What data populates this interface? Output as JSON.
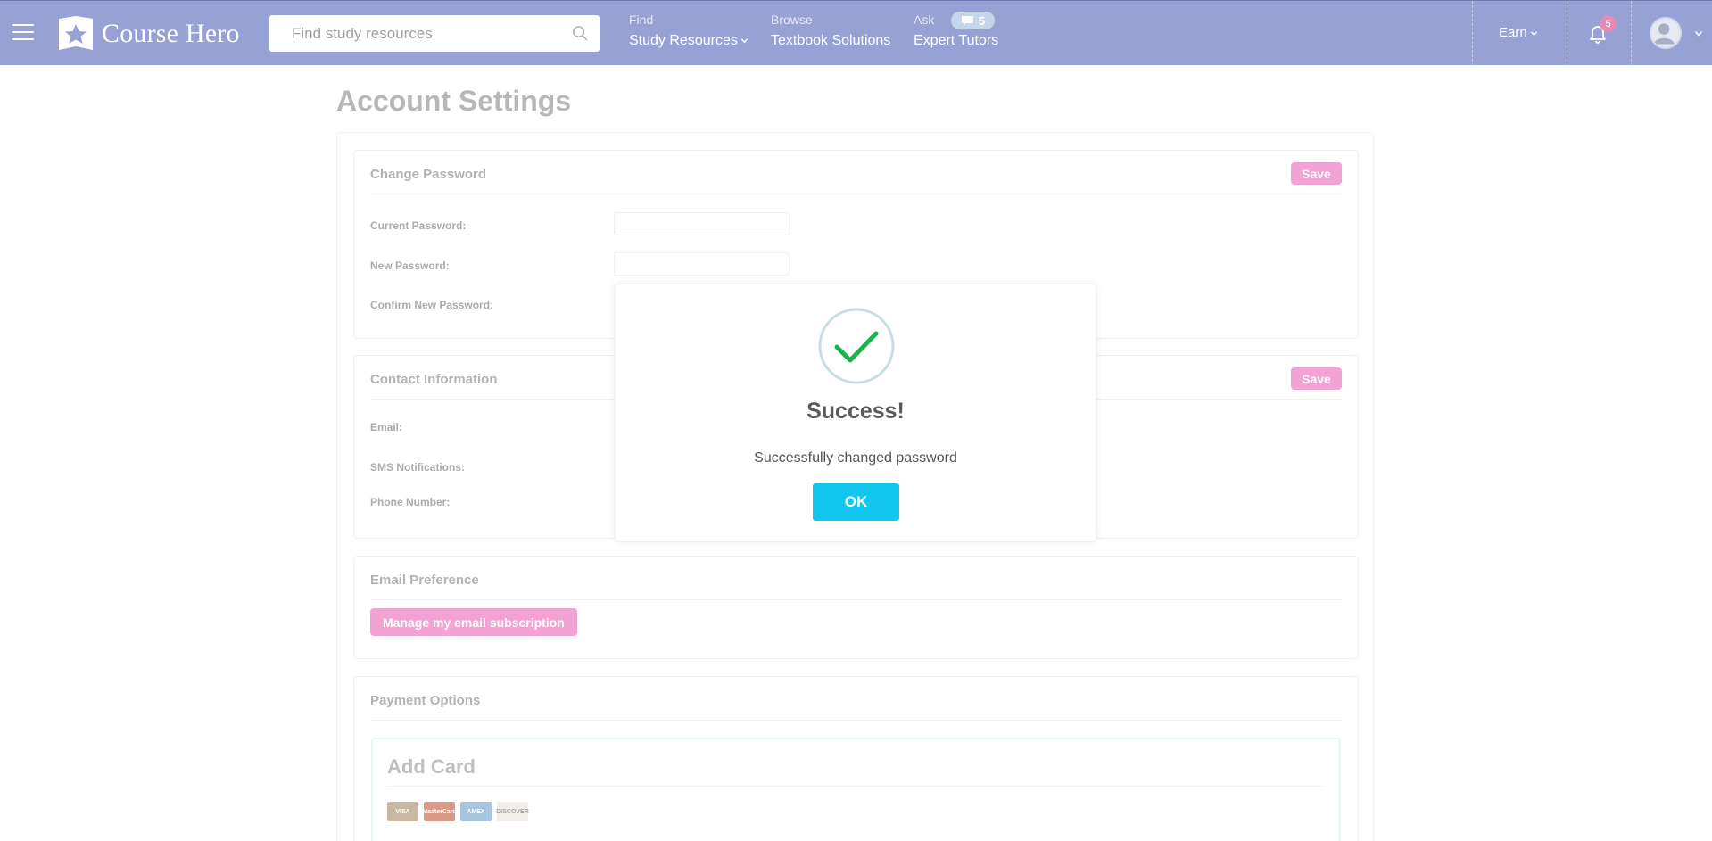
{
  "header": {
    "logo_text": "Course Hero",
    "search_placeholder": "Find study resources",
    "nav": [
      {
        "small": "Find",
        "label": "Study Resources"
      },
      {
        "small": "Browse",
        "label": "Textbook Solutions"
      },
      {
        "small": "Ask",
        "label": "Expert Tutors",
        "badge": "5"
      }
    ],
    "earn_label": "Earn",
    "notification_count": "5",
    "colors": {
      "bar": "#98a1d4"
    }
  },
  "page": {
    "title": "Account Settings"
  },
  "change_password": {
    "title": "Change Password",
    "save_label": "Save",
    "current_label": "Current Password:",
    "new_label": "New Password:",
    "confirm_label": "Confirm New Password:"
  },
  "contact": {
    "title": "Contact Information",
    "save_label": "Save",
    "email_label": "Email:",
    "sms_label": "SMS Notifications:",
    "phone_label": "Phone Number:"
  },
  "email_pref": {
    "title": "Email Preference",
    "manage_label": "Manage my email subscription"
  },
  "payment": {
    "title": "Payment Options",
    "add_card_title": "Add Card",
    "card_brands": [
      "VISA",
      "MasterCard",
      "AMEX",
      "DISCOVER"
    ]
  },
  "modal": {
    "title": "Success!",
    "message": "Successfully changed password",
    "ok_label": "OK",
    "icon": "check-circle-icon",
    "colors": {
      "ok": "#12c6ee",
      "check": "#1bb44b"
    }
  }
}
